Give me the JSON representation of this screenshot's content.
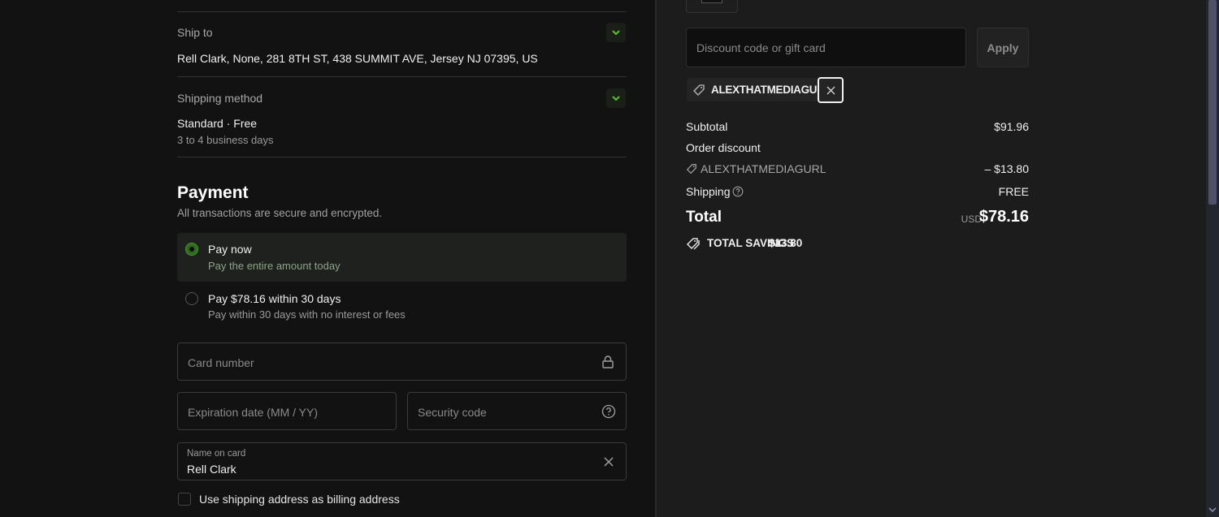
{
  "shipping": {
    "ship_to_label": "Ship to",
    "ship_to_value": "Rell Clark, None, 281 8TH ST, 438 SUMMIT AVE, Jersey NJ 07395, US",
    "method_label": "Shipping method",
    "method_value": "Standard · Free",
    "method_sub": "3 to 4 business days"
  },
  "payment": {
    "title": "Payment",
    "subtitle": "All transactions are secure and encrypted.",
    "options": [
      {
        "title": "Pay now",
        "subtitle": "Pay the entire amount today",
        "selected": true
      },
      {
        "title": "Pay $78.16 within 30 days",
        "subtitle": "Pay within 30 days with no interest or fees",
        "selected": false
      }
    ],
    "card_number_placeholder": "Card number",
    "expiration_placeholder": "Expiration date (MM / YY)",
    "security_placeholder": "Security code",
    "name_label": "Name on card",
    "name_value": "Rell Clark",
    "billing_checkbox_label": "Use shipping address as billing address",
    "billing_checked": false
  },
  "summary": {
    "discount_placeholder": "Discount code or gift card",
    "apply_label": "Apply",
    "applied_code": "ALEXTHATMEDIAGURL",
    "subtotal_label": "Subtotal",
    "subtotal_value": "$91.96",
    "order_discount_label": "Order discount",
    "discount_code": "ALEXTHATMEDIAGURL",
    "discount_value": "– $13.80",
    "shipping_label": "Shipping",
    "shipping_value": "FREE",
    "total_label": "Total",
    "currency": "USD",
    "total_value": "$78.16",
    "savings_label": "TOTAL SAVINGS",
    "savings_value": "$13.80"
  },
  "colors": {
    "accent": "#4a9a2a",
    "left_bg": "#121212",
    "right_bg": "#1c1c1c"
  }
}
